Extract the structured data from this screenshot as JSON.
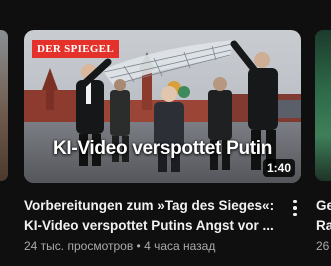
{
  "main_card": {
    "channel_logo": "DER SPIEGEL",
    "overlay_title": "KI-Video verspottet Putin",
    "duration": "1:40",
    "title_line1": "Vorbereitungen zum »Tag des Sieges«:",
    "title_line2": "KI-Video verspottet Putins Angst vor ...",
    "meta": "24 тыс. просмотров • 4 часа назад"
  },
  "next_card": {
    "title_line1": "Ge",
    "title_line2": "Ra",
    "meta": "26"
  },
  "icons": {
    "more": "more-vert-icon"
  }
}
